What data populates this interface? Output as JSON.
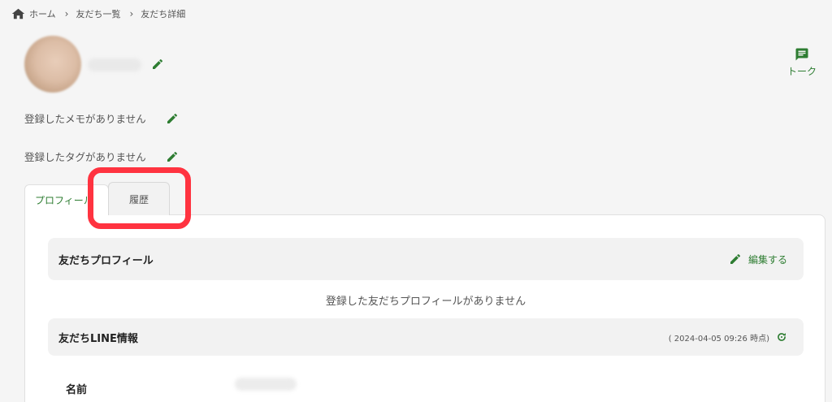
{
  "breadcrumb": {
    "home": "ホーム",
    "list": "友だち一覧",
    "detail": "友だち詳細"
  },
  "header": {
    "talk_label": "トーク"
  },
  "memo": {
    "empty_text": "登録したメモがありません"
  },
  "tag": {
    "empty_text": "登録したタグがありません"
  },
  "tabs": [
    {
      "label": "プロフィール"
    },
    {
      "label": "履歴"
    }
  ],
  "profile_section": {
    "title": "友だちプロフィール",
    "edit_label": "編集する",
    "empty_text": "登録した友だちプロフィールがありません"
  },
  "line_section": {
    "title": "友だちLINE情報",
    "timestamp": "( 2024-04-05 09:26 時点)",
    "fields": [
      {
        "label": "名前"
      }
    ]
  },
  "colors": {
    "accent": "#2e7d32",
    "highlight": "#ff3340"
  },
  "icons": [
    "home-icon",
    "chevron-right-icon",
    "pencil-icon",
    "chat-icon",
    "refresh-icon"
  ]
}
